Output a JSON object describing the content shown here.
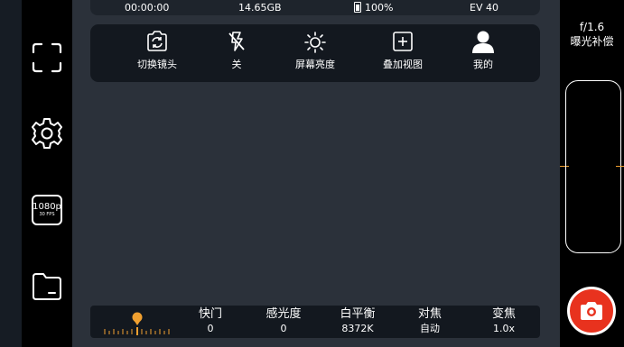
{
  "status_bar": {
    "recording_time": "00:00:00",
    "storage": "14.65GB",
    "battery": "100%",
    "ev": "EV 40"
  },
  "left_bar": {
    "resolution_top": "1080p",
    "resolution_bottom": "30 FPS"
  },
  "menu": {
    "items": [
      {
        "label": "切换镜头",
        "icon": "switch-camera-icon"
      },
      {
        "label": "关",
        "icon": "flash-off-icon"
      },
      {
        "label": "屏幕亮度",
        "icon": "brightness-icon"
      },
      {
        "label": "叠加视图",
        "icon": "overlay-add-icon"
      },
      {
        "label": "我的",
        "icon": "person-icon"
      }
    ]
  },
  "bottom_params": [
    {
      "label": "快门",
      "value": "0"
    },
    {
      "label": "感光度",
      "value": "0"
    },
    {
      "label": "白平衡",
      "value": "8372K"
    },
    {
      "label": "对焦",
      "value": "自动"
    },
    {
      "label": "变焦",
      "value": "1.0x"
    }
  ],
  "right_bar": {
    "aperture": "f/1.6",
    "exposure_label": "曝光补偿"
  },
  "colors": {
    "accent": "#f0a030",
    "shutter": "#e8321e",
    "viewfinder": "#2b313a",
    "panel": "#13181f"
  }
}
